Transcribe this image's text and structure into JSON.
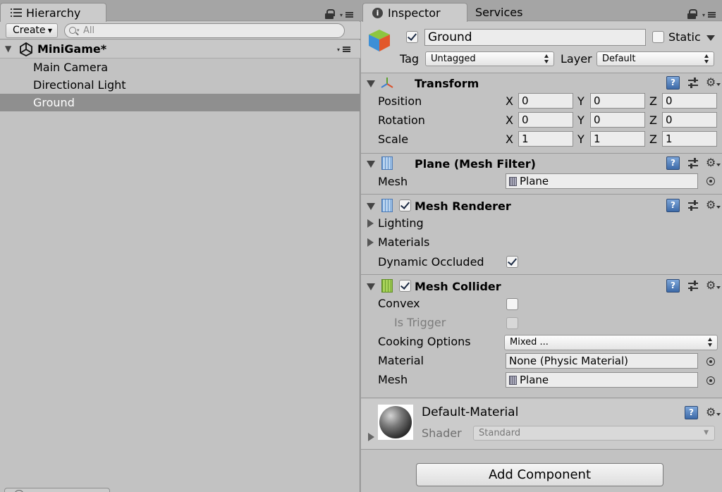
{
  "hierarchy": {
    "tab_label": "Hierarchy",
    "create_label": "Create",
    "search_placeholder": "All",
    "scene_name": "MiniGame*",
    "objects": [
      "Main Camera",
      "Directional Light",
      "Ground"
    ],
    "selected": "Ground"
  },
  "inspector": {
    "tab_label": "Inspector",
    "services_label": "Services",
    "object_name": "Ground",
    "active": true,
    "static_label": "Static",
    "static_checked": false,
    "tag_label": "Tag",
    "tag_value": "Untagged",
    "layer_label": "Layer",
    "layer_value": "Default",
    "transform": {
      "title": "Transform",
      "position_label": "Position",
      "rotation_label": "Rotation",
      "scale_label": "Scale",
      "x_label": "X",
      "y_label": "Y",
      "z_label": "Z",
      "position": [
        "0",
        "0",
        "0"
      ],
      "rotation": [
        "0",
        "0",
        "0"
      ],
      "scale": [
        "1",
        "1",
        "1"
      ]
    },
    "mesh_filter": {
      "title": "Plane (Mesh Filter)",
      "mesh_label": "Mesh",
      "mesh_value": "Plane"
    },
    "mesh_renderer": {
      "title": "Mesh Renderer",
      "enabled": true,
      "lighting_label": "Lighting",
      "materials_label": "Materials",
      "dynamic_occluded_label": "Dynamic Occluded",
      "dynamic_occluded": true
    },
    "mesh_collider": {
      "title": "Mesh Collider",
      "enabled": true,
      "convex_label": "Convex",
      "convex": false,
      "is_trigger_label": "Is Trigger",
      "is_trigger": false,
      "cooking_label": "Cooking Options",
      "cooking_value": "Mixed ...",
      "material_label": "Material",
      "material_value": "None (Physic Material)",
      "mesh_label": "Mesh",
      "mesh_value": "Plane"
    },
    "material": {
      "name": "Default-Material",
      "shader_label": "Shader",
      "shader_value": "Standard"
    },
    "add_component_label": "Add Component"
  },
  "colors": {
    "panel_bg": "#c2c2c2",
    "tab_bar": "#a5a5a5",
    "selection": "#8f8f8f",
    "help_icon": "#4a78b5"
  }
}
